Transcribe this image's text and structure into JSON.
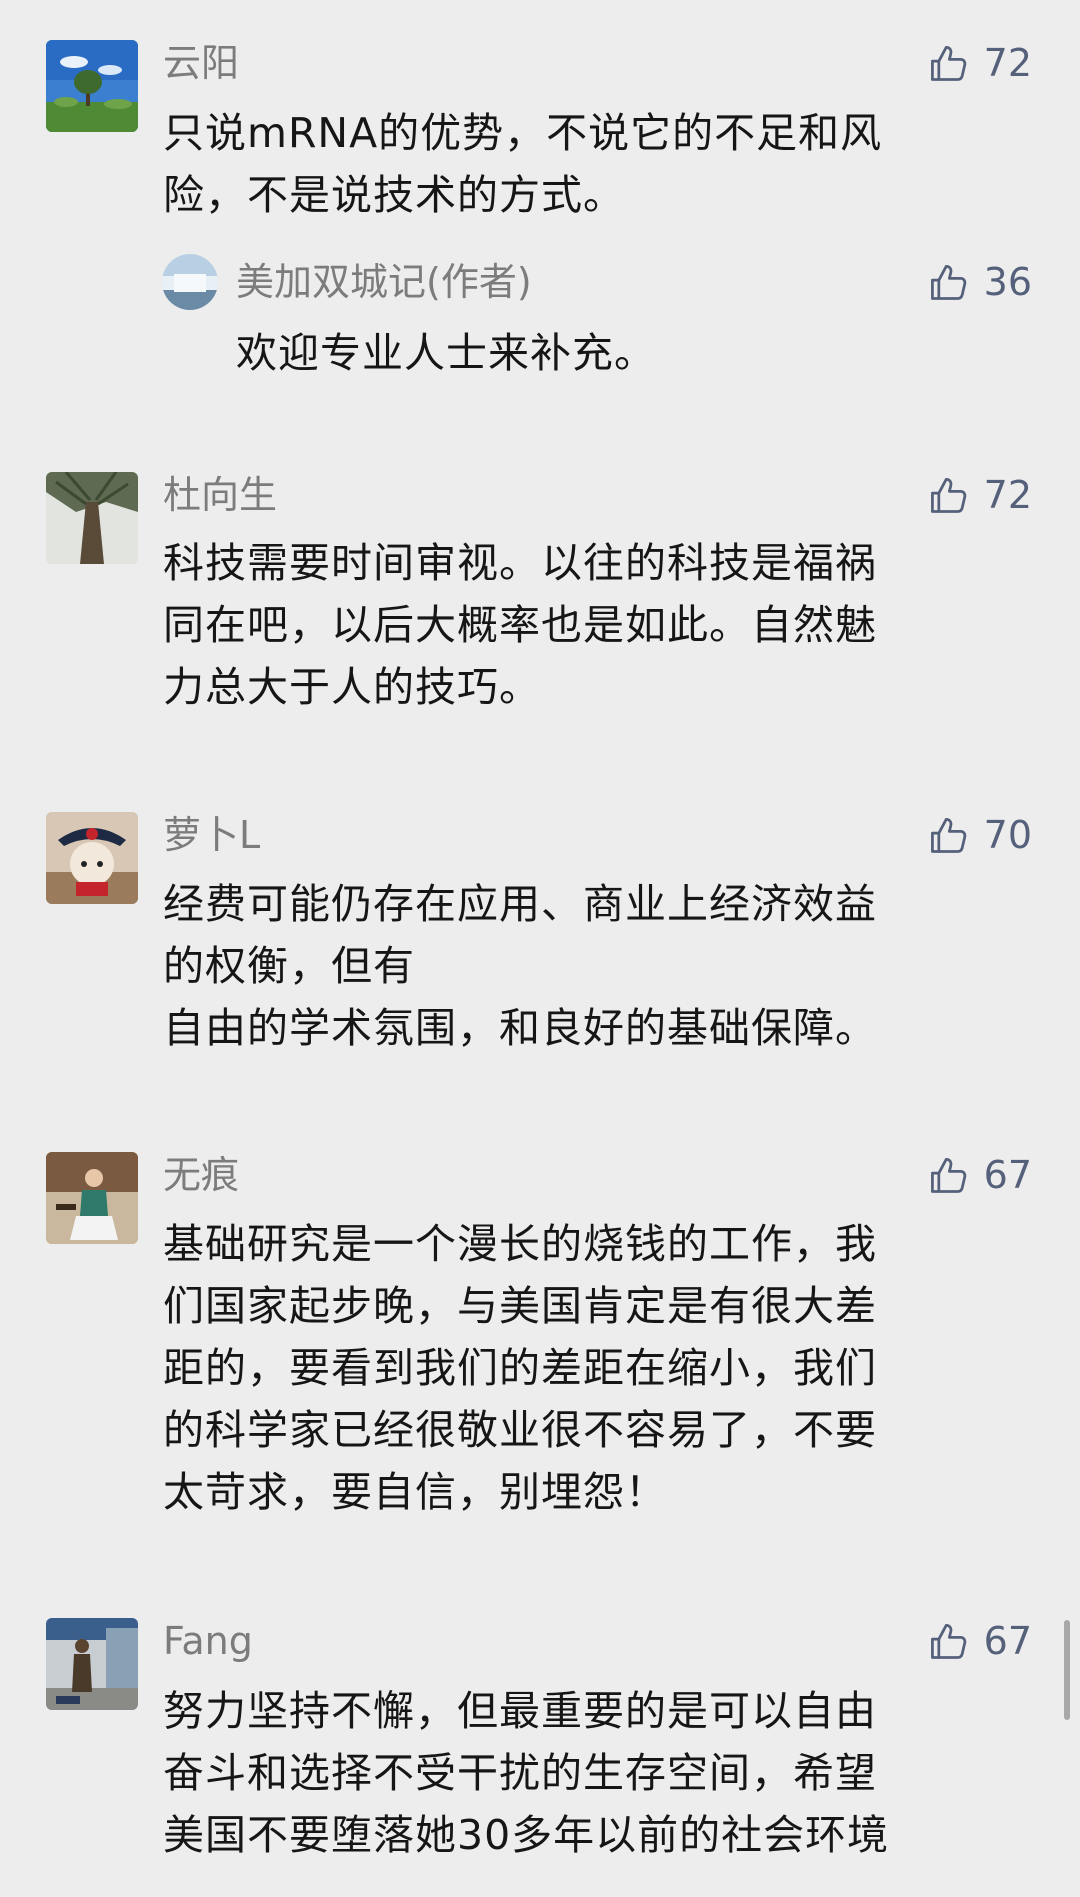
{
  "comments": [
    {
      "name": "云阳",
      "likes": "72",
      "text": "只说mRNA的优势，不说它的不足和风\n险，不是说技术的方式。",
      "avatar": "sky-tree-avatar",
      "reply": {
        "name": "美加双城记(作者)",
        "likes": "36",
        "text": "欢迎专业人士来补充。",
        "avatar": "waterfall-avatar"
      }
    },
    {
      "name": "杜向生",
      "likes": "72",
      "text": "科技需要时间审视。以往的科技是福祸\n同在吧，以后大概率也是如此。自然魅\n力总大于人的技巧。",
      "avatar": "tall-tree-avatar"
    },
    {
      "name": "萝卜L",
      "likes": "70",
      "text": "经费可能仍存在应用、商业上经济效益\n的权衡，但有\n自由的学术氛围，和良好的基础保障。",
      "avatar": "cartoon-hat-avatar"
    },
    {
      "name": "无痕",
      "likes": "67",
      "text": "基础研究是一个漫长的烧钱的工作，我\n们国家起步晚，与美国肯定是有很大差\n距的，要看到我们的差距在缩小，我们\n的科学家已经很敬业很不容易了，不要\n太苛求，要自信，别埋怨！",
      "avatar": "woman-photo-avatar"
    },
    {
      "name": "Fang",
      "likes": "67",
      "text": "努力坚持不懈，但最重要的是可以自由\n奋斗和选择不受干扰的生存空间，希望\n美国不要堕落她30多年以前的社会环境",
      "avatar": "statue-photo-avatar"
    }
  ],
  "colors": {
    "background": "#ededed",
    "name": "#7c7c7c",
    "like": "#55607a",
    "text": "#161616"
  },
  "icons": {
    "like": "thumbs-up-icon"
  }
}
